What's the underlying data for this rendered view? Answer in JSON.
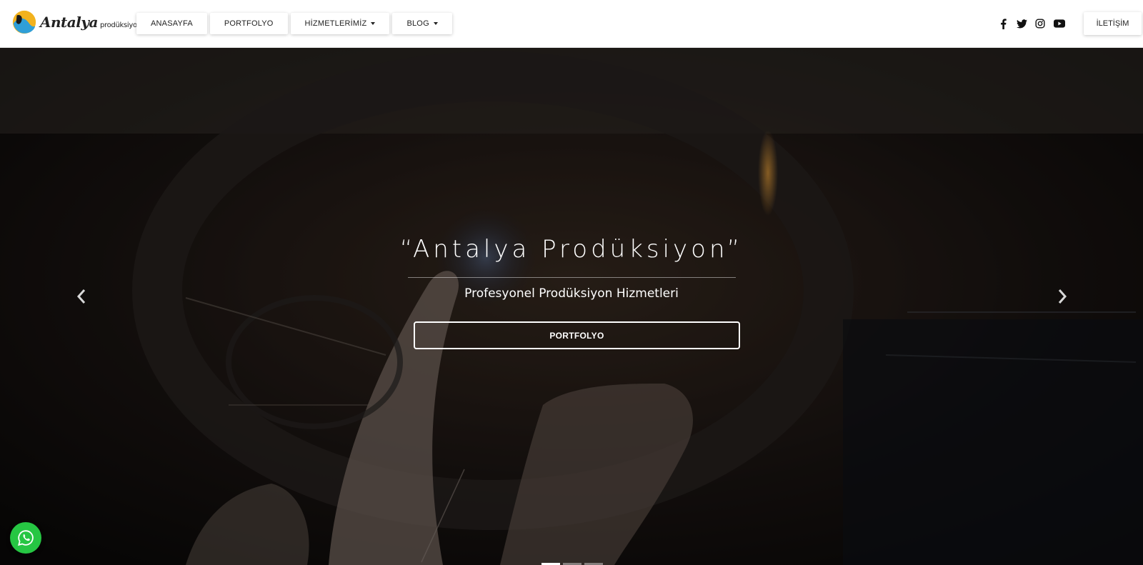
{
  "brand": {
    "logo_main": "Antalya",
    "logo_sub": "prodüksiyon"
  },
  "nav": {
    "items": [
      {
        "label": "ANASAYFA",
        "has_dropdown": false
      },
      {
        "label": "PORTFOLYO",
        "has_dropdown": false
      },
      {
        "label": "HİZMETLERİMİZ",
        "has_dropdown": true
      },
      {
        "label": "BLOG",
        "has_dropdown": true
      }
    ]
  },
  "social": {
    "icons": [
      "facebook-icon",
      "twitter-icon",
      "instagram-icon",
      "youtube-icon"
    ]
  },
  "header": {
    "contact_label": "İLETİŞİM"
  },
  "hero": {
    "title": "“Antalya Prodüksiyon”",
    "subtitle": "Profesyonel Prodüksiyon Hizmetleri",
    "cta_label": "PORTFOLYO",
    "slide_count": 3,
    "active_slide": 1
  },
  "colors": {
    "whatsapp": "#26c643",
    "header_bg": "#ffffff",
    "text_dark": "#222222"
  }
}
